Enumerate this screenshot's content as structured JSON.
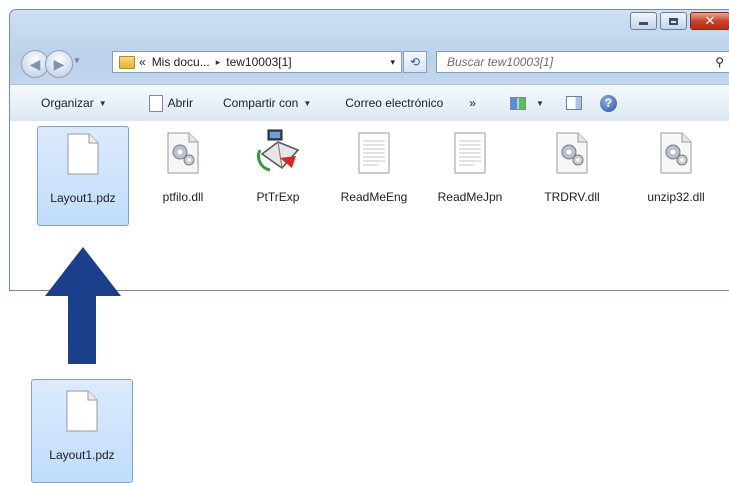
{
  "window": {
    "minimize_icon": "minimize-icon",
    "maximize_icon": "maximize-icon",
    "close_icon": "close-icon"
  },
  "address": {
    "overflow": "«",
    "path": [
      "Mis docu...",
      "tew10003[1]"
    ],
    "separator": "▸",
    "dropdown": "▾",
    "refresh": "⟲"
  },
  "search": {
    "placeholder": "Buscar tew10003[1]",
    "icon": "search-icon"
  },
  "commands": {
    "organize": "Organizar",
    "open": "Abrir",
    "share": "Compartir con",
    "email": "Correo electrónico",
    "more": "»"
  },
  "files": [
    {
      "name": "Layout1.pdz",
      "icon": "document-icon",
      "selected": true
    },
    {
      "name": "ptfilo.dll",
      "icon": "dll-gear-icon"
    },
    {
      "name": "PtTrExp",
      "icon": "setup-program-icon"
    },
    {
      "name": "ReadMeEng",
      "icon": "text-file-icon"
    },
    {
      "name": "ReadMeJpn",
      "icon": "text-file-icon"
    },
    {
      "name": "TRDRV.dll",
      "icon": "dll-gear-icon"
    },
    {
      "name": "unzip32.dll",
      "icon": "dll-gear-icon"
    }
  ],
  "drag_file": {
    "name": "Layout1.pdz",
    "icon": "document-icon"
  },
  "colors": {
    "arrow": "#1b3f8b",
    "selection": "#c1dcfc"
  }
}
